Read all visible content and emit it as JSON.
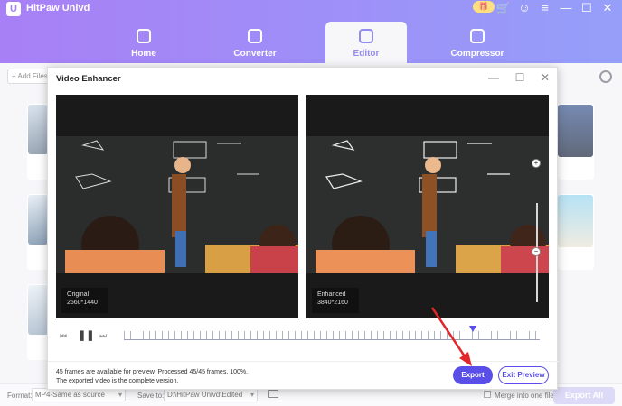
{
  "app": {
    "title": "HitPaw Univd",
    "logo_letter": "U"
  },
  "window_controls": {
    "gift": "🎁",
    "cart": "🛒",
    "account": "☺",
    "menu": "≡",
    "minimize": "—",
    "maximize": "☐",
    "close": "✕"
  },
  "nav": {
    "tabs": [
      {
        "label": "Home",
        "icon": "home-icon",
        "active": false
      },
      {
        "label": "Converter",
        "icon": "converter-icon",
        "active": false
      },
      {
        "label": "Editor",
        "icon": "editor-icon",
        "active": true
      },
      {
        "label": "Compressor",
        "icon": "compressor-icon",
        "active": false
      }
    ]
  },
  "toolbar": {
    "add_files_label": "+ Add Files"
  },
  "dialog": {
    "title": "Video Enhancer",
    "controls": {
      "minimize": "—",
      "maximize": "☐",
      "close": "✕"
    },
    "original": {
      "label": "Original",
      "resolution": "2560*1440"
    },
    "enhanced": {
      "label": "Enhanced",
      "resolution": "3840*2160"
    },
    "zoom": {
      "in": "+",
      "out": "−"
    },
    "playback": {
      "prev": "⏮",
      "play_pause": "❚❚",
      "next": "⏭",
      "progress": 0.84
    },
    "status_line_1": "45 frames are available for preview. Processed 45/45 frames, 100%.",
    "status_line_2": "The exported video is the complete version.",
    "export_label": "Export",
    "exit_preview_label": "Exit Preview"
  },
  "bottom": {
    "format_label": "Format:",
    "format_value": "MP4-Same as source",
    "save_to_label": "Save to:",
    "save_to_value": "D:\\HitPaw Univd\\Edited",
    "merge_label": "Merge into one file",
    "export_all_label": "Export All"
  },
  "colors": {
    "accent": "#5a4ee8",
    "annotation_arrow": "#e3262a"
  }
}
